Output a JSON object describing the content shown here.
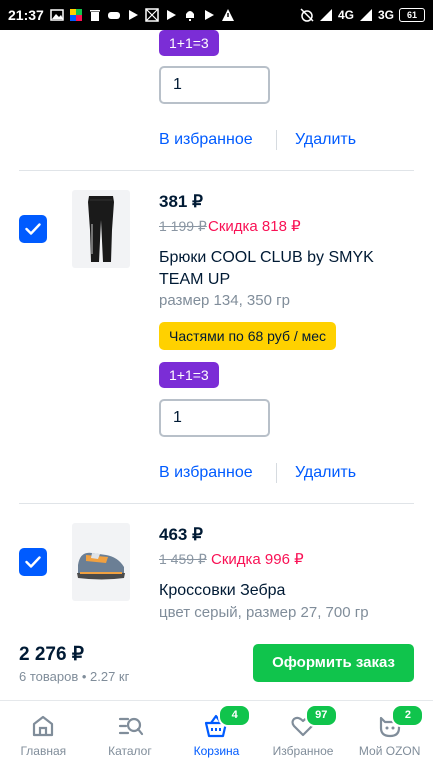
{
  "status_bar": {
    "time": "21:37",
    "network_1": "4G",
    "network_2": "3G",
    "battery": "61"
  },
  "cart": {
    "top_partial": {
      "promo": "1+1=3",
      "quantity": "1",
      "favorite_label": "В избранное",
      "delete_label": "Удалить"
    },
    "items": [
      {
        "price": "381 ₽",
        "old_price": "1 199 ₽",
        "discount": "Скидка 818 ₽",
        "title": "Брюки COOL CLUB by SMYK TEAM UP",
        "meta": "размер 134, 350 гр",
        "installments": "Частями по 68 руб / мес",
        "promo": "1+1=3",
        "quantity": "1",
        "favorite_label": "В избранное",
        "delete_label": "Удалить",
        "checked": true
      },
      {
        "price": "463 ₽",
        "old_price": "1 459 ₽",
        "discount": "Скидка 996 ₽",
        "title": "Кроссовки Зебра",
        "meta": "цвет серый, размер 27, 700 гр",
        "checked": true
      }
    ]
  },
  "checkout": {
    "total": "2 276 ₽",
    "summary": "6 товаров • 2.27 кг",
    "button_label": "Оформить заказ"
  },
  "nav": {
    "items": [
      {
        "label": "Главная",
        "icon": "home-icon"
      },
      {
        "label": "Каталог",
        "icon": "catalog-icon"
      },
      {
        "label": "Корзина",
        "icon": "cart-icon",
        "badge": "4"
      },
      {
        "label": "Избранное",
        "icon": "heart-icon",
        "badge": "97"
      },
      {
        "label": "Мой OZON",
        "icon": "profile-icon",
        "badge": "2"
      }
    ],
    "active_color": "#005bff",
    "badge_color": "#10c44c"
  },
  "colors": {
    "accent": "#005bff",
    "discount": "#f91155",
    "promo": "#7b2dd6",
    "installments": "#ffd100",
    "order_button": "#10c44c"
  }
}
